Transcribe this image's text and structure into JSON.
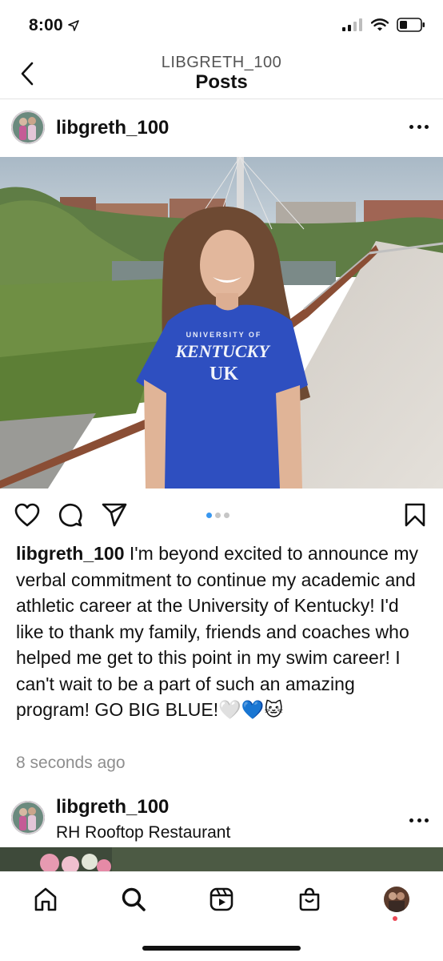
{
  "status_bar": {
    "time": "8:00"
  },
  "header": {
    "subtitle": "LIBGRETH_100",
    "title": "Posts"
  },
  "post": {
    "username": "libgreth_100",
    "shirt_line1": "UNIVERSITY OF",
    "shirt_line2": "KENTUCKY",
    "shirt_logo": "UK",
    "carousel": {
      "count": 3,
      "active_index": 0
    },
    "caption_user": "libgreth_100",
    "caption_text": " I'm beyond excited to announce my verbal commitment to continue my academic and athletic career at the University of Kentucky! I'd like to thank my family, friends and coaches who helped me get to this point in my swim career! I can't wait to be a part of such an amazing program! GO BIG BLUE!🤍💙🐱",
    "timestamp": "8 seconds ago"
  },
  "post2": {
    "username": "libgreth_100",
    "location": "RH Rooftop Restaurant"
  },
  "tabs": [
    "home-icon",
    "search-icon",
    "reels-icon",
    "shop-icon",
    "profile-avatar"
  ],
  "colors": {
    "accent": "#3897f0",
    "notification": "#ed4956",
    "muted": "#8e8e8e"
  }
}
